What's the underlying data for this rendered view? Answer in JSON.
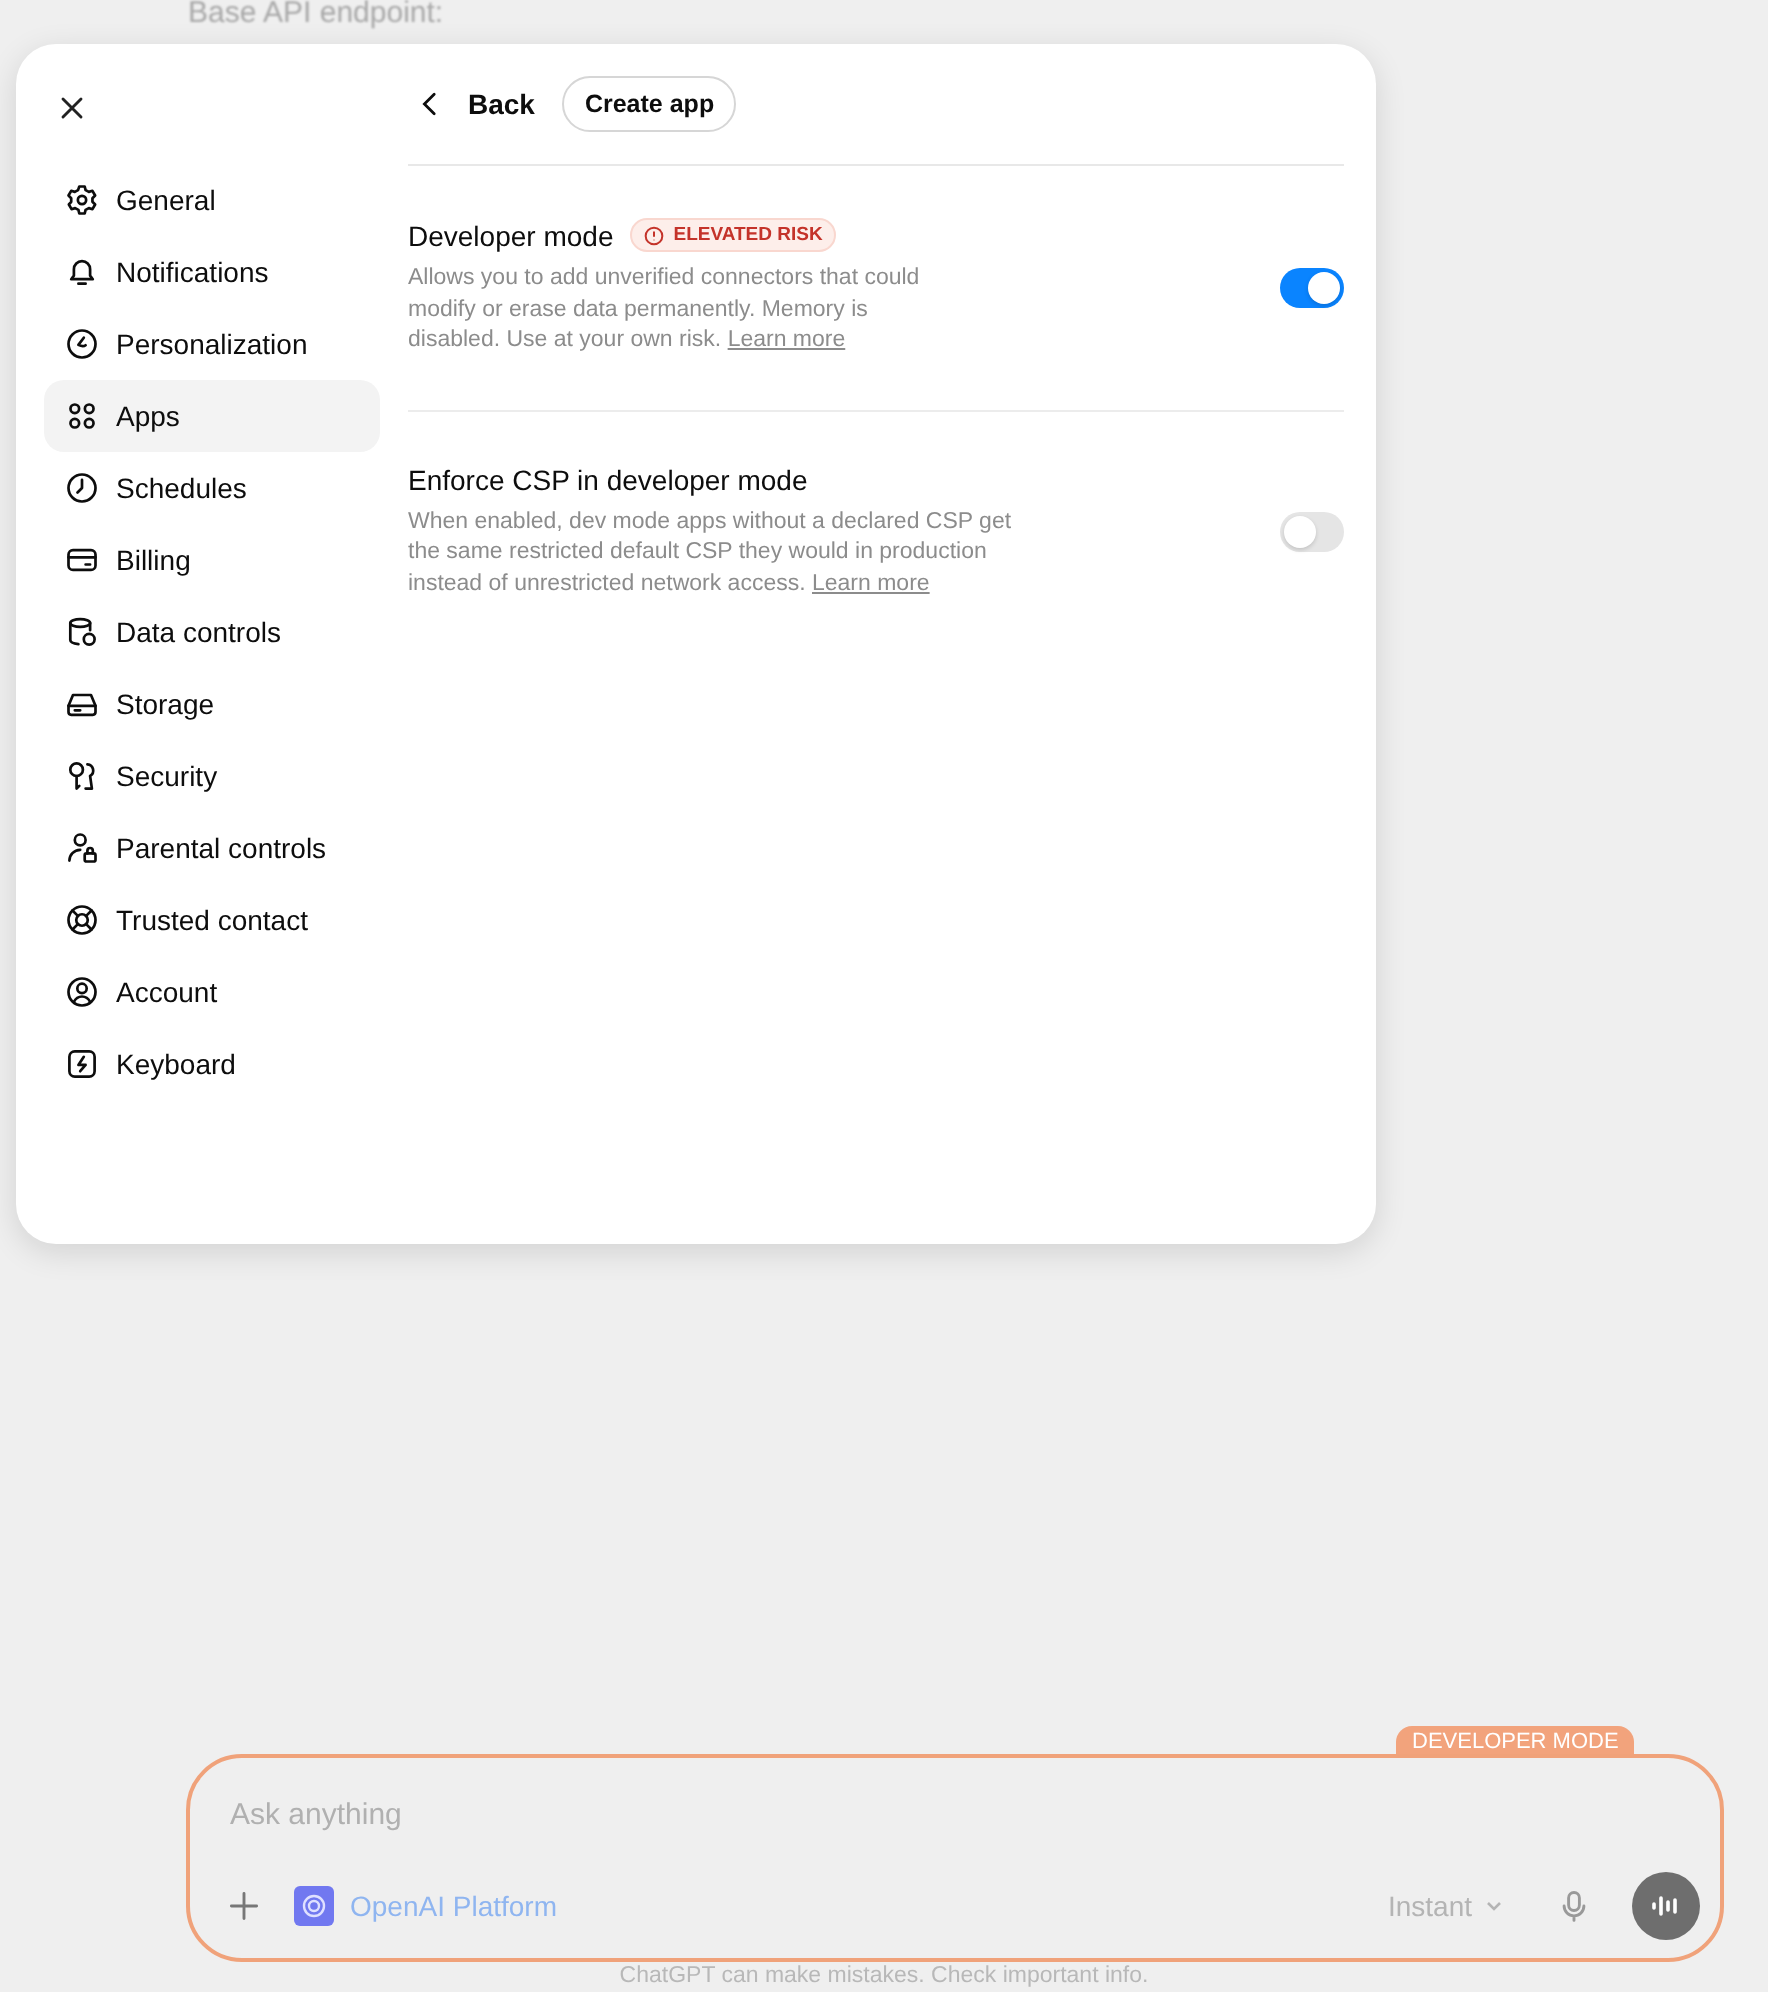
{
  "background": {
    "heading": "Base API endpoint:",
    "composer": {
      "badge": "DEVELOPER MODE",
      "placeholder": "Ask anything",
      "connector": "OpenAI Platform",
      "model": "Instant"
    },
    "footer": "ChatGPT can make mistakes. Check important info."
  },
  "sidebar": {
    "items": [
      {
        "label": "General",
        "selected": false
      },
      {
        "label": "Notifications",
        "selected": false
      },
      {
        "label": "Personalization",
        "selected": false
      },
      {
        "label": "Apps",
        "selected": true
      },
      {
        "label": "Schedules",
        "selected": false
      },
      {
        "label": "Billing",
        "selected": false
      },
      {
        "label": "Data controls",
        "selected": false
      },
      {
        "label": "Storage",
        "selected": false
      },
      {
        "label": "Security",
        "selected": false
      },
      {
        "label": "Parental controls",
        "selected": false
      },
      {
        "label": "Trusted contact",
        "selected": false
      },
      {
        "label": "Account",
        "selected": false
      },
      {
        "label": "Keyboard",
        "selected": false
      }
    ]
  },
  "header": {
    "back": "Back",
    "create": "Create app"
  },
  "settings": [
    {
      "title": "Developer mode",
      "badge": "ELEVATED RISK",
      "description": "Allows you to add unverified connectors that could modify or erase data permanently. Memory is disabled. Use at your own risk.",
      "link": "Learn more",
      "on": true
    },
    {
      "title": "Enforce CSP in developer mode",
      "description": "When enabled, dev mode apps without a declared CSP get the same restricted default CSP they would in production instead of unrestricted network access.",
      "link": "Learn more",
      "on": false
    }
  ]
}
